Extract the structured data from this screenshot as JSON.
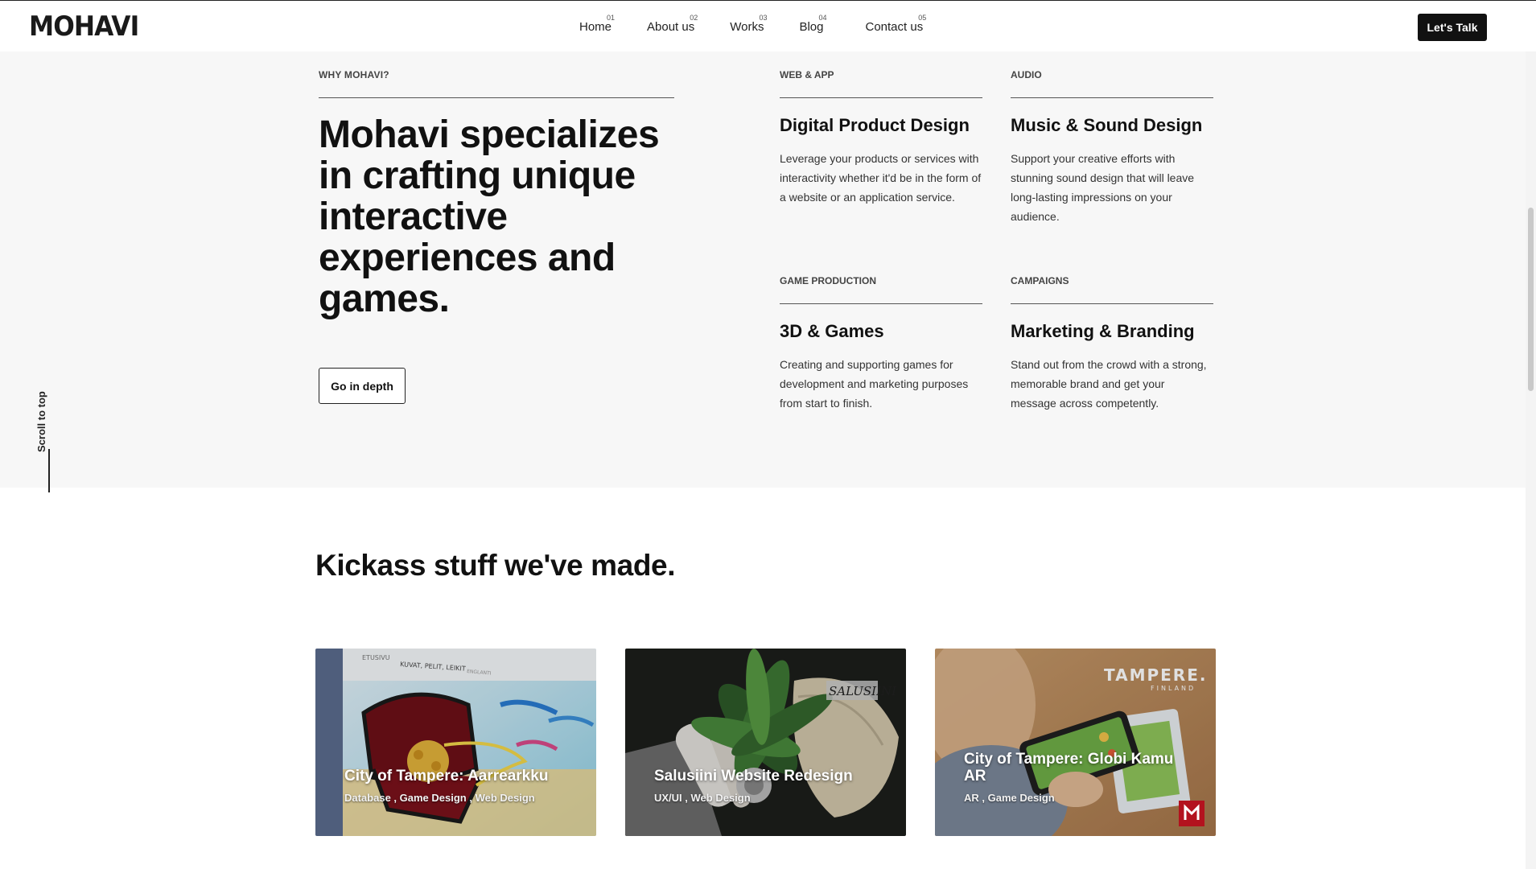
{
  "header": {
    "logo": "MOHAVI",
    "nav": [
      {
        "num": "01",
        "label": "Home"
      },
      {
        "num": "02",
        "label": "About us"
      },
      {
        "num": "03",
        "label": "Works"
      },
      {
        "num": "04",
        "label": "Blog"
      },
      {
        "num": "05",
        "label": "Contact us"
      }
    ],
    "cta": "Let's Talk"
  },
  "why": {
    "kicker": "WHY MOHAVI?",
    "heading": "Mohavi specializes in crafting unique interactive experiences and games.",
    "button": "Go in depth"
  },
  "services": [
    {
      "kicker": "WEB & APP",
      "title": "Digital Product Design",
      "desc": "Leverage your products or services with interactivity whether it'd be in the form of a website or an application service."
    },
    {
      "kicker": "AUDIO",
      "title": "Music & Sound Design",
      "desc": "Support your creative efforts with stunning sound design that will leave long-lasting impressions on your audience."
    },
    {
      "kicker": "GAME PRODUCTION",
      "title": "3D & Games",
      "desc": "Creating and supporting games for development and marketing purposes from start to finish."
    },
    {
      "kicker": "CAMPAIGNS",
      "title": "Marketing & Branding",
      "desc": "Stand out from the crowd with a strong, memorable brand and get your message across competently."
    }
  ],
  "scroll_top": "Scroll to top",
  "works": {
    "title": "Kickass stuff we've made.",
    "cards": [
      {
        "title": "City of Tampere: Aarrearkku",
        "tags": "Database , Game Design , Web Design",
        "image_text": [
          "ETUSIVU",
          "KUVAT, PELIT, LEIKIT",
          "ENGLANTI"
        ]
      },
      {
        "title": "Salusiini Website Redesign",
        "tags": "UX/UI , Web Design",
        "image_text": [
          "SALUSIINI"
        ]
      },
      {
        "title": "City of Tampere: Globi Kamu AR",
        "tags": "AR , Game Design",
        "image_text": [
          "TAMPERE.",
          "FINLAND"
        ]
      }
    ]
  },
  "colors": {
    "accent_dark": "#111111",
    "section_bg": "#f7f7f7",
    "brand_red": "#b3121e"
  }
}
